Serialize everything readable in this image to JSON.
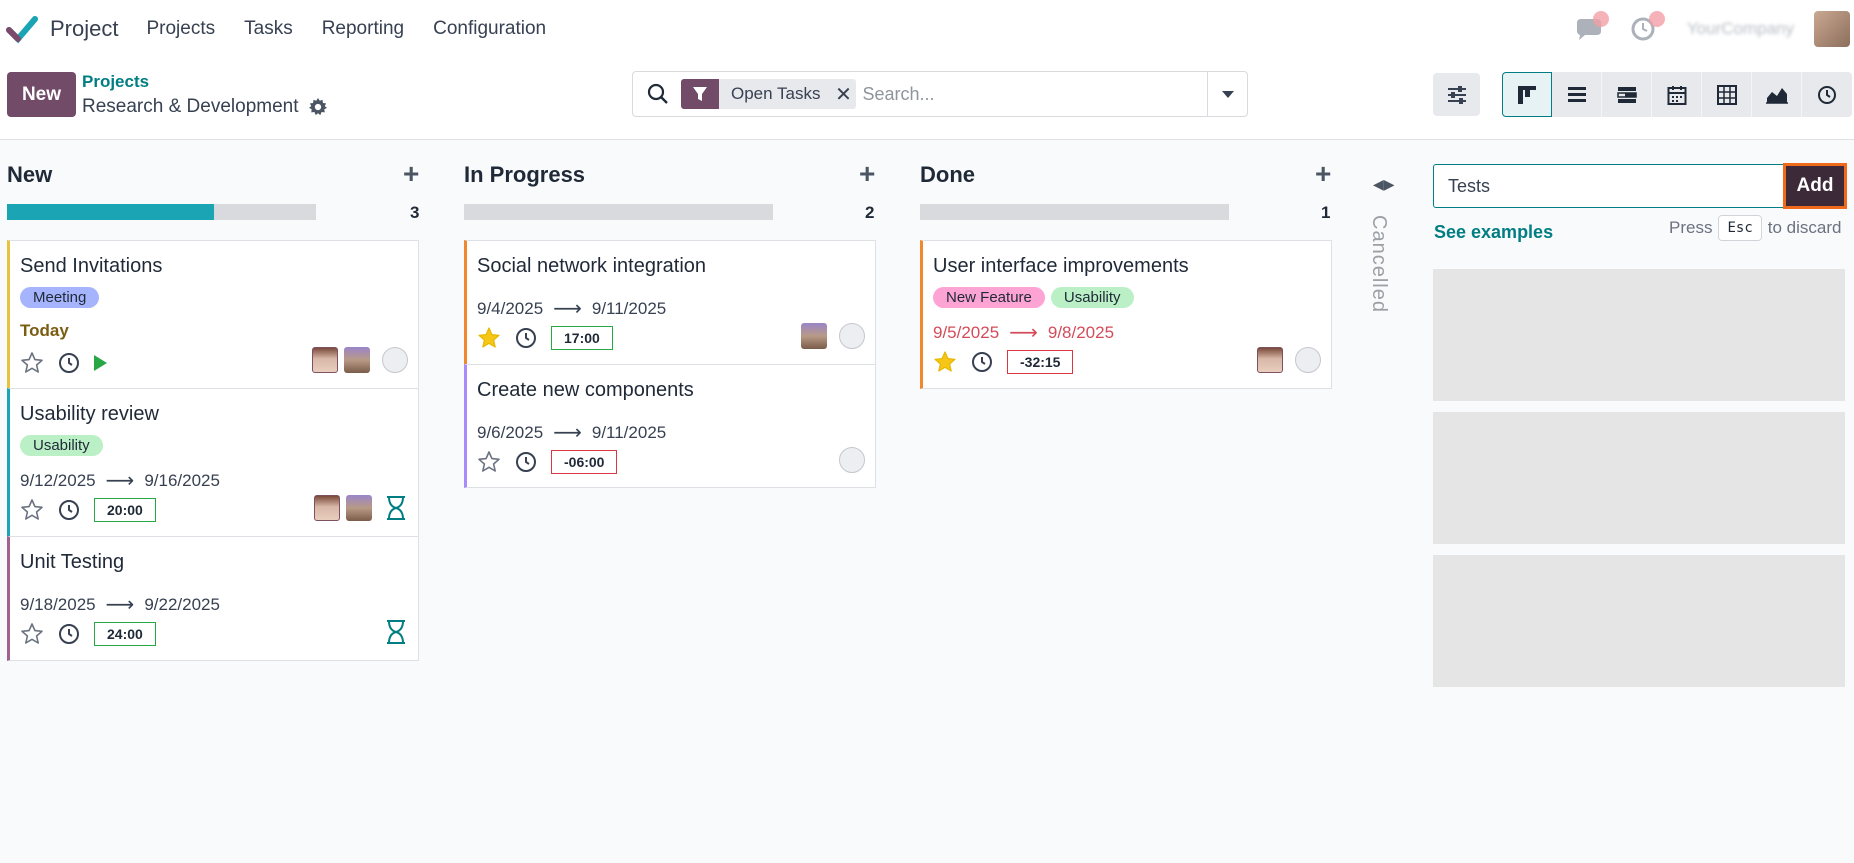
{
  "navbar": {
    "app_name": "Project",
    "menu": [
      "Projects",
      "Tasks",
      "Reporting",
      "Configuration"
    ],
    "company": "YourCompany",
    "icons": [
      "chat-icon",
      "activity-icon"
    ]
  },
  "control": {
    "new_label": "New",
    "breadcrumb_parent": "Projects",
    "breadcrumb_current": "Research & Development",
    "search": {
      "facet": "Open Tasks",
      "placeholder": "Search..."
    },
    "views": [
      "kanban",
      "list",
      "gantt",
      "calendar",
      "pivot",
      "graph",
      "activity"
    ]
  },
  "columns": [
    {
      "name": "New",
      "count": "3",
      "progress": 0.67,
      "cards": [
        {
          "title": "Send Invitations",
          "tags": [
            {
              "label": "Meeting",
              "color": "#a5b4fc"
            }
          ],
          "deadline_text": "Today",
          "starred": false,
          "avatars": [
            "glasses",
            "beard"
          ],
          "status": "normal",
          "running": true
        },
        {
          "title": "Usability review",
          "tags": [
            {
              "label": "Usability",
              "color": "#bbf0c7"
            }
          ],
          "date_start": "9/12/2025",
          "date_end": "9/16/2025",
          "time": "20:00",
          "starred": false,
          "avatars": [
            "glasses",
            "beard"
          ],
          "waiting": true
        },
        {
          "title": "Unit Testing",
          "date_start": "9/18/2025",
          "date_end": "9/22/2025",
          "time": "24:00",
          "starred": false,
          "waiting": true
        }
      ]
    },
    {
      "name": "In Progress",
      "count": "2",
      "progress": 0,
      "cards": [
        {
          "title": "Social network integration",
          "date_start": "9/4/2025",
          "date_end": "9/11/2025",
          "time": "17:00",
          "starred": true,
          "avatars": [
            "beard"
          ]
        },
        {
          "title": "Create new components",
          "date_start": "9/6/2025",
          "date_end": "9/11/2025",
          "time": "-06:00",
          "starred": false
        }
      ]
    },
    {
      "name": "Done",
      "count": "1",
      "progress": 0,
      "cards": [
        {
          "title": "User interface improvements",
          "tags": [
            {
              "label": "New Feature",
              "color": "#fda4d4"
            },
            {
              "label": "Usability",
              "color": "#bbf0c7"
            }
          ],
          "date_start": "9/5/2025",
          "date_end": "9/8/2025",
          "overdue": true,
          "time": "-32:15",
          "starred": true,
          "avatars": [
            "glasses"
          ]
        }
      ]
    }
  ],
  "folded_column": "Cancelled",
  "quick_create": {
    "value": "Tests",
    "add_label": "Add",
    "see_examples": "See examples",
    "press": "Press",
    "key": "Esc",
    "to_discard": "to discard"
  },
  "colors": {
    "brand": "#714b67",
    "accent": "#017e84",
    "progress": "#1ba4b4",
    "highlight": "#f06a1b"
  }
}
